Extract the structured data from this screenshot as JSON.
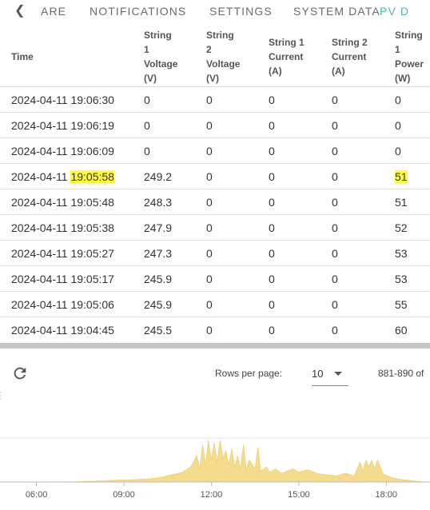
{
  "nav": {
    "tabs": [
      {
        "label": "ARE"
      },
      {
        "label": "NOTIFICATIONS"
      },
      {
        "label": "SETTINGS"
      },
      {
        "label": "SYSTEM DATA"
      },
      {
        "label": "PV D",
        "active": true
      }
    ]
  },
  "table": {
    "columns": [
      {
        "line1": "Time",
        "line2": "",
        "line3": "",
        "line4": ""
      },
      {
        "line1": "String",
        "line2": "1",
        "line3": "Voltage",
        "line4": "(V)"
      },
      {
        "line1": "String",
        "line2": "2",
        "line3": "Voltage",
        "line4": "(V)"
      },
      {
        "line1": "String 1",
        "line2": "Current",
        "line3": "(A)",
        "line4": ""
      },
      {
        "line1": "String 2",
        "line2": "Current",
        "line3": "(A)",
        "line4": ""
      },
      {
        "line1": "String",
        "line2": "1",
        "line3": "Power",
        "line4": "(W)"
      }
    ],
    "rows": [
      {
        "date": "2024-04-11",
        "time": "19:06:30",
        "s1v": "0",
        "s2v": "0",
        "s1c": "0",
        "s2c": "0",
        "s1p": "0"
      },
      {
        "date": "2024-04-11",
        "time": "19:06:19",
        "s1v": "0",
        "s2v": "0",
        "s1c": "0",
        "s2c": "0",
        "s1p": "0"
      },
      {
        "date": "2024-04-11",
        "time": "19:06:09",
        "s1v": "0",
        "s2v": "0",
        "s1c": "0",
        "s2c": "0",
        "s1p": "0"
      },
      {
        "date": "2024-04-11",
        "time": "19:05:58",
        "s1v": "249.2",
        "s2v": "0",
        "s1c": "0",
        "s2c": "0",
        "s1p": "51",
        "highlight": true
      },
      {
        "date": "2024-04-11",
        "time": "19:05:48",
        "s1v": "248.3",
        "s2v": "0",
        "s1c": "0",
        "s2c": "0",
        "s1p": "51"
      },
      {
        "date": "2024-04-11",
        "time": "19:05:38",
        "s1v": "247.9",
        "s2v": "0",
        "s1c": "0",
        "s2c": "0",
        "s1p": "52"
      },
      {
        "date": "2024-04-11",
        "time": "19:05:27",
        "s1v": "247.3",
        "s2v": "0",
        "s1c": "0",
        "s2c": "0",
        "s1p": "53"
      },
      {
        "date": "2024-04-11",
        "time": "19:05:17",
        "s1v": "245.9",
        "s2v": "0",
        "s1c": "0",
        "s2c": "0",
        "s1p": "53"
      },
      {
        "date": "2024-04-11",
        "time": "19:05:06",
        "s1v": "245.9",
        "s2v": "0",
        "s1c": "0",
        "s2c": "0",
        "s1p": "55"
      },
      {
        "date": "2024-04-11",
        "time": "19:04:45",
        "s1v": "245.5",
        "s2v": "0",
        "s1c": "0",
        "s2c": "0",
        "s1p": "60"
      }
    ]
  },
  "pagination": {
    "rows_per_page_label": "Rows per page:",
    "rows_per_page_value": "10",
    "range_text": "881-890 of"
  },
  "chart_data": {
    "type": "area",
    "x_ticks": [
      "06:00",
      "09:00",
      "12:00",
      "15:00",
      "18:00"
    ],
    "x_tick_hours": [
      6,
      9,
      12,
      15,
      18
    ],
    "x_range_hours": [
      4.75,
      19.5
    ],
    "y_range": [
      0,
      1
    ],
    "grid": true,
    "color": "#f5dc8c",
    "series": [
      {
        "points": [
          [
            4.75,
            0
          ],
          [
            6.4,
            0
          ],
          [
            7.4,
            0.01
          ],
          [
            8.0,
            0.02
          ],
          [
            8.6,
            0.04
          ],
          [
            9.2,
            0.05
          ],
          [
            9.8,
            0.07
          ],
          [
            10.2,
            0.1
          ],
          [
            10.6,
            0.16
          ],
          [
            11.0,
            0.22
          ],
          [
            11.3,
            0.35
          ],
          [
            11.5,
            0.6
          ],
          [
            11.6,
            0.3
          ],
          [
            11.7,
            0.85
          ],
          [
            11.8,
            0.4
          ],
          [
            11.9,
            0.95
          ],
          [
            12.0,
            0.5
          ],
          [
            12.1,
            0.9
          ],
          [
            12.2,
            0.45
          ],
          [
            12.3,
            0.95
          ],
          [
            12.4,
            0.55
          ],
          [
            12.5,
            0.7
          ],
          [
            12.6,
            0.4
          ],
          [
            12.7,
            0.75
          ],
          [
            12.8,
            0.35
          ],
          [
            12.9,
            0.6
          ],
          [
            13.0,
            0.3
          ],
          [
            13.1,
            0.85
          ],
          [
            13.2,
            0.28
          ],
          [
            13.3,
            0.5
          ],
          [
            13.5,
            0.3
          ],
          [
            13.6,
            0.8
          ],
          [
            13.7,
            0.25
          ],
          [
            13.9,
            0.35
          ],
          [
            14.0,
            0.22
          ],
          [
            14.2,
            0.3
          ],
          [
            14.4,
            0.2
          ],
          [
            14.6,
            0.25
          ],
          [
            14.8,
            0.3
          ],
          [
            15.0,
            0.22
          ],
          [
            15.3,
            0.28
          ],
          [
            15.6,
            0.2
          ],
          [
            16.0,
            0.16
          ],
          [
            16.3,
            0.14
          ],
          [
            16.6,
            0.2
          ],
          [
            16.9,
            0.14
          ],
          [
            17.0,
            0.3
          ],
          [
            17.1,
            0.45
          ],
          [
            17.2,
            0.25
          ],
          [
            17.3,
            0.5
          ],
          [
            17.4,
            0.35
          ],
          [
            17.5,
            0.5
          ],
          [
            17.6,
            0.3
          ],
          [
            17.7,
            0.5
          ],
          [
            17.9,
            0.18
          ],
          [
            18.2,
            0.1
          ],
          [
            18.5,
            0.06
          ],
          [
            18.9,
            0.03
          ],
          [
            19.2,
            0.01
          ],
          [
            19.5,
            0
          ]
        ]
      }
    ]
  }
}
